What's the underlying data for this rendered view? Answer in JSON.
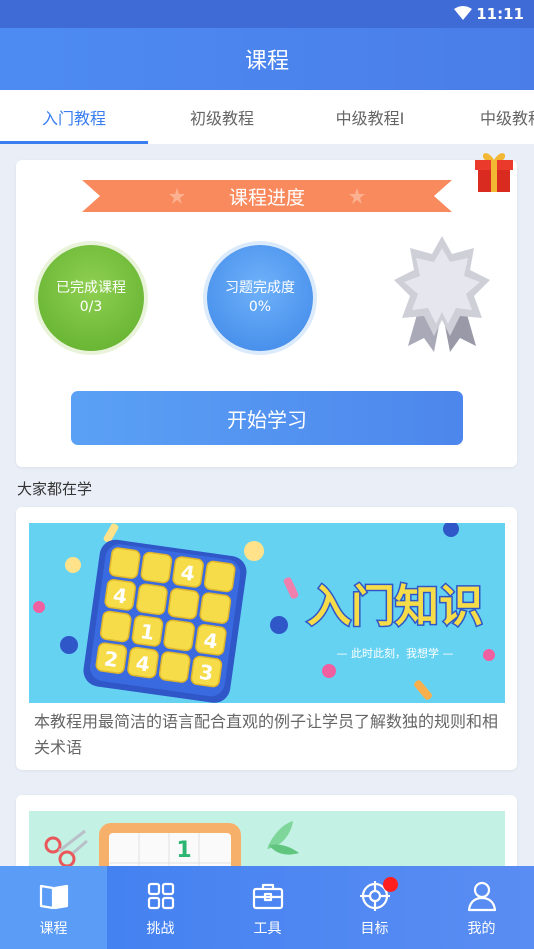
{
  "status_bar": {
    "time": "11:11"
  },
  "app_bar": {
    "title": "课程"
  },
  "tabs": [
    {
      "label": "入门教程",
      "active": true
    },
    {
      "label": "初级教程",
      "active": false
    },
    {
      "label": "中级教程I",
      "active": false
    },
    {
      "label": "中级教程",
      "active": false
    }
  ],
  "progress": {
    "ribbon_title": "课程进度",
    "completed_courses": {
      "label": "已完成课程",
      "value": "0/3"
    },
    "exercise_completion": {
      "label": "习题完成度",
      "value": "0%"
    },
    "start_button": "开始学习"
  },
  "section": {
    "title": "大家都在学"
  },
  "courses": [
    {
      "banner_title": "入门知识",
      "banner_subtitle": "— 此时此刻，我想学 —",
      "sudoku_digits": [
        "4",
        "4",
        "1",
        "4",
        "2",
        "4",
        "3"
      ],
      "description": "本教程用最简洁的语言配合直观的例子让学员了解数独的规则和相关术语"
    },
    {
      "banner_digit": "1"
    }
  ],
  "bottom_nav": [
    {
      "label": "课程",
      "icon": "book-icon",
      "active": true
    },
    {
      "label": "挑战",
      "icon": "grid-icon",
      "active": false
    },
    {
      "label": "工具",
      "icon": "toolbox-icon",
      "active": false
    },
    {
      "label": "目标",
      "icon": "target-icon",
      "active": false,
      "badge": true
    },
    {
      "label": "我的",
      "icon": "user-icon",
      "active": false
    }
  ],
  "colors": {
    "primary": "#4a86ee",
    "ribbon": "#f98a5e",
    "completed_circle": "#6dbb36",
    "exercise_circle": "#4a92ec",
    "badge": "#ff1f1f"
  }
}
